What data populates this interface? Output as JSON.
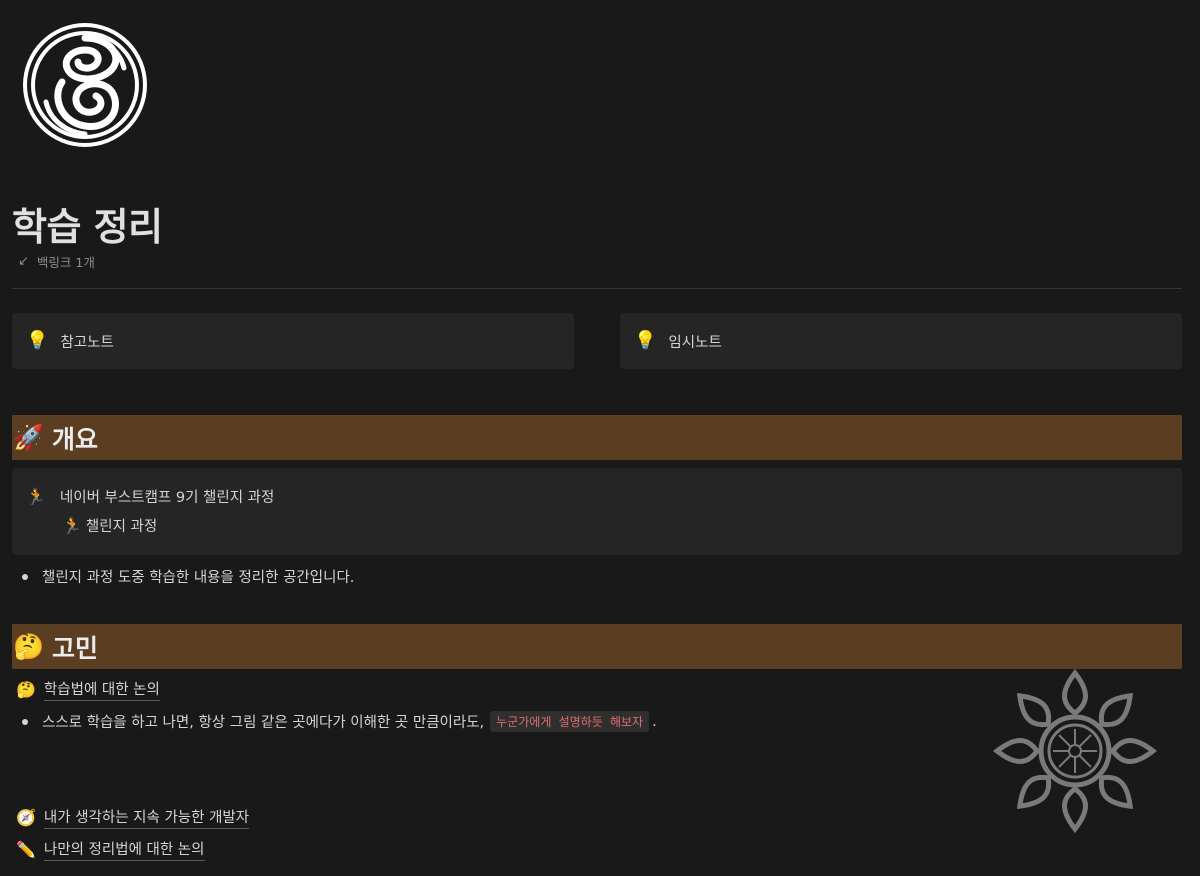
{
  "page": {
    "title": "학습 정리",
    "backlinks": "백링크 1개"
  },
  "callouts": [
    {
      "icon": "lightbulb-icon",
      "label": "참고노트"
    },
    {
      "icon": "lightbulb-icon",
      "label": "임시노트"
    }
  ],
  "section_overview": {
    "emoji": "🚀",
    "title": "개요",
    "info_title": "네이버 부스트캠프 9기 챌린지 과정",
    "info_link": "챌린지 과정",
    "bullet": "챌린지 과정 도중 학습한 내용을 정리한 공간입니다."
  },
  "section_concern": {
    "emoji": "🤔",
    "title": "고민",
    "subpage": "학습법에 대한 논의",
    "bullet_text": "스스로 학습을 하고 나면, 항상 그림 같은 곳에다가 이해한 곳 만큼이라도,",
    "bullet_code": "누군가에게 설명하듯 해보자",
    "bullet_end": "."
  },
  "links": [
    {
      "emoji": "🧭",
      "label": "내가 생각하는 지속 가능한 개발자"
    },
    {
      "emoji": "✏️",
      "label": "나만의 정리법에 대한 논의"
    }
  ],
  "colors": {
    "background": "#191919",
    "heading_bar": "#5b3d22",
    "callout_bg": "#252525",
    "code_text": "#e06c6c"
  }
}
